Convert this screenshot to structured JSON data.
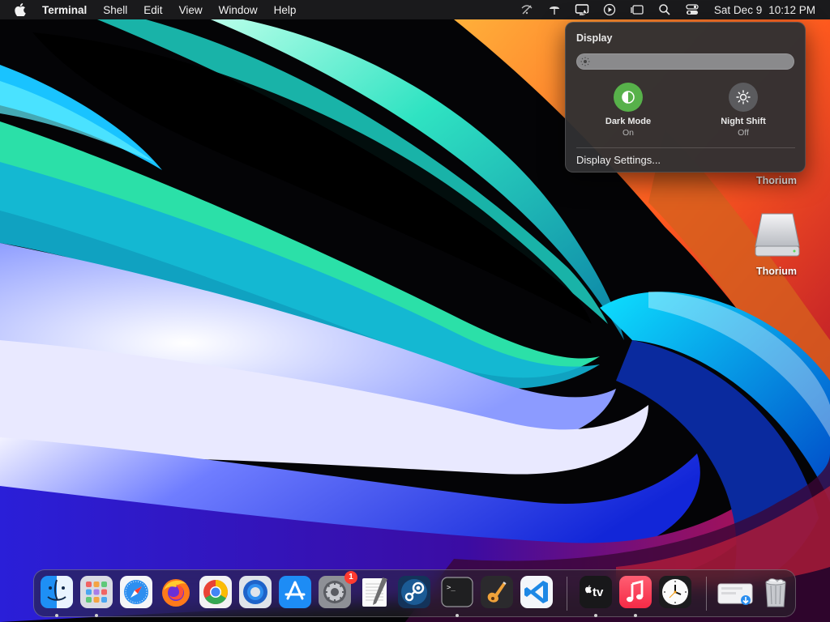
{
  "menubar": {
    "app_name": "Terminal",
    "items": [
      "Shell",
      "Edit",
      "View",
      "Window",
      "Help"
    ],
    "status_icons": [
      "wifi-off-icon",
      "airdrop-icon",
      "display-icon",
      "play-icon",
      "stage-manager-icon",
      "search-icon",
      "control-center-icon"
    ],
    "date": "Sat Dec 9",
    "time": "10:12 PM"
  },
  "display_popover": {
    "title": "Display",
    "brightness": 0.0,
    "dark_mode": {
      "label": "Dark Mode",
      "state": "On"
    },
    "night_shift": {
      "label": "Night Shift",
      "state": "Off"
    },
    "settings_link": "Display Settings..."
  },
  "desktop": {
    "icons": [
      {
        "label": "Thorium",
        "icon": "app-icon"
      },
      {
        "label": "Thorium",
        "icon": "drive-icon"
      }
    ]
  },
  "dock": {
    "apps": [
      {
        "name": "Finder",
        "icon": "finder-icon",
        "running": true
      },
      {
        "name": "Launchpad",
        "icon": "launchpad-icon",
        "running": true
      },
      {
        "name": "Safari",
        "icon": "safari-icon",
        "running": false
      },
      {
        "name": "Firefox",
        "icon": "firefox-icon",
        "running": false
      },
      {
        "name": "Chrome",
        "icon": "chrome-icon",
        "running": false
      },
      {
        "name": "Thorium",
        "icon": "thorium-icon",
        "running": false
      },
      {
        "name": "App Store",
        "icon": "app-store-icon",
        "running": false
      },
      {
        "name": "System Settings",
        "icon": "settings-icon",
        "running": false,
        "badge": "1"
      },
      {
        "name": "TextEdit",
        "icon": "textedit-icon",
        "running": false
      },
      {
        "name": "Steam",
        "icon": "steam-icon",
        "running": false
      },
      {
        "name": "Terminal",
        "icon": "terminal-icon",
        "running": true
      },
      {
        "name": "GarageBand",
        "icon": "garageband-icon",
        "running": false
      },
      {
        "name": "VS Code",
        "icon": "vscode-icon",
        "running": false
      },
      {
        "name": "Apple TV",
        "icon": "appletv-icon",
        "running": true,
        "label": "tv"
      },
      {
        "name": "Music",
        "icon": "music-icon",
        "running": true
      },
      {
        "name": "Clock",
        "icon": "clock-icon",
        "running": false
      },
      {
        "name": "Downloads",
        "icon": "downloads-icon",
        "running": false
      },
      {
        "name": "Trash",
        "icon": "trash-icon",
        "running": false
      }
    ]
  },
  "colors": {
    "dark_mode_on": "#57b14a",
    "menubar_bg": "#1c1c1e",
    "badge": "#ff3b30",
    "vscode_blue": "#1e88e5"
  }
}
